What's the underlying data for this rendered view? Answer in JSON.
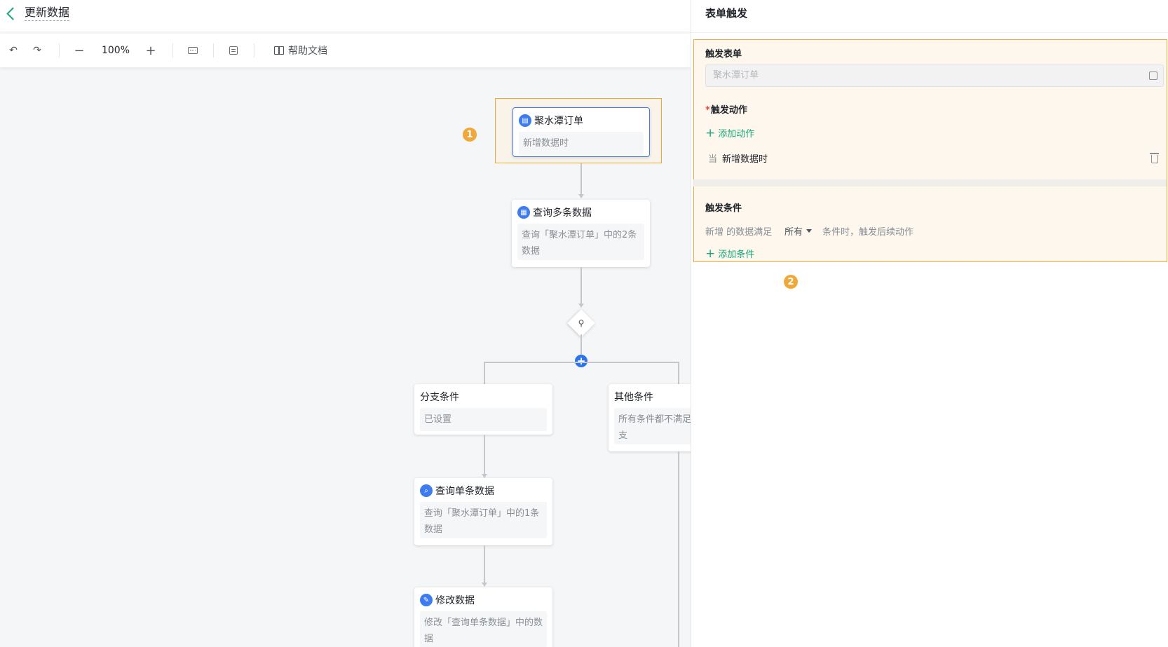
{
  "header": {
    "title": "更新数据"
  },
  "toolbar": {
    "zoom": "100%",
    "help_label": "帮助文档"
  },
  "flow": {
    "trigger": {
      "title": "聚水潭订单",
      "desc": "新增数据时",
      "badge": "1"
    },
    "query_multi": {
      "title": "查询多条数据",
      "desc": "查询「聚水潭订单」中的2条数据"
    },
    "branch_a": {
      "title": "分支条件",
      "desc": "已设置"
    },
    "branch_b": {
      "title": "其他条件",
      "desc": "所有条件都不满足时进入本分支"
    },
    "query_single": {
      "title": "查询单条数据",
      "desc": "查询「聚水潭订单」中的1条数据"
    },
    "update": {
      "title": "修改数据",
      "desc": "修改「查询单条数据」中的数据"
    }
  },
  "panel": {
    "title": "表单触发",
    "badge": "2",
    "trigger_form": {
      "label": "触发表单",
      "placeholder": "聚水潭订单"
    },
    "trigger_action": {
      "label": "触发动作",
      "required": "*",
      "add_label": "添加动作",
      "when": "当",
      "action": "新增数据时"
    },
    "trigger_condition": {
      "label": "触发条件",
      "prefix": "新增 的数据满足",
      "select": "所有",
      "suffix": "条件时，触发后续动作",
      "add_label": "添加条件"
    }
  },
  "colors": {
    "accent": "#1aa57a",
    "highlight": "#f0a83a",
    "node_icon": "#3d7bf0"
  }
}
